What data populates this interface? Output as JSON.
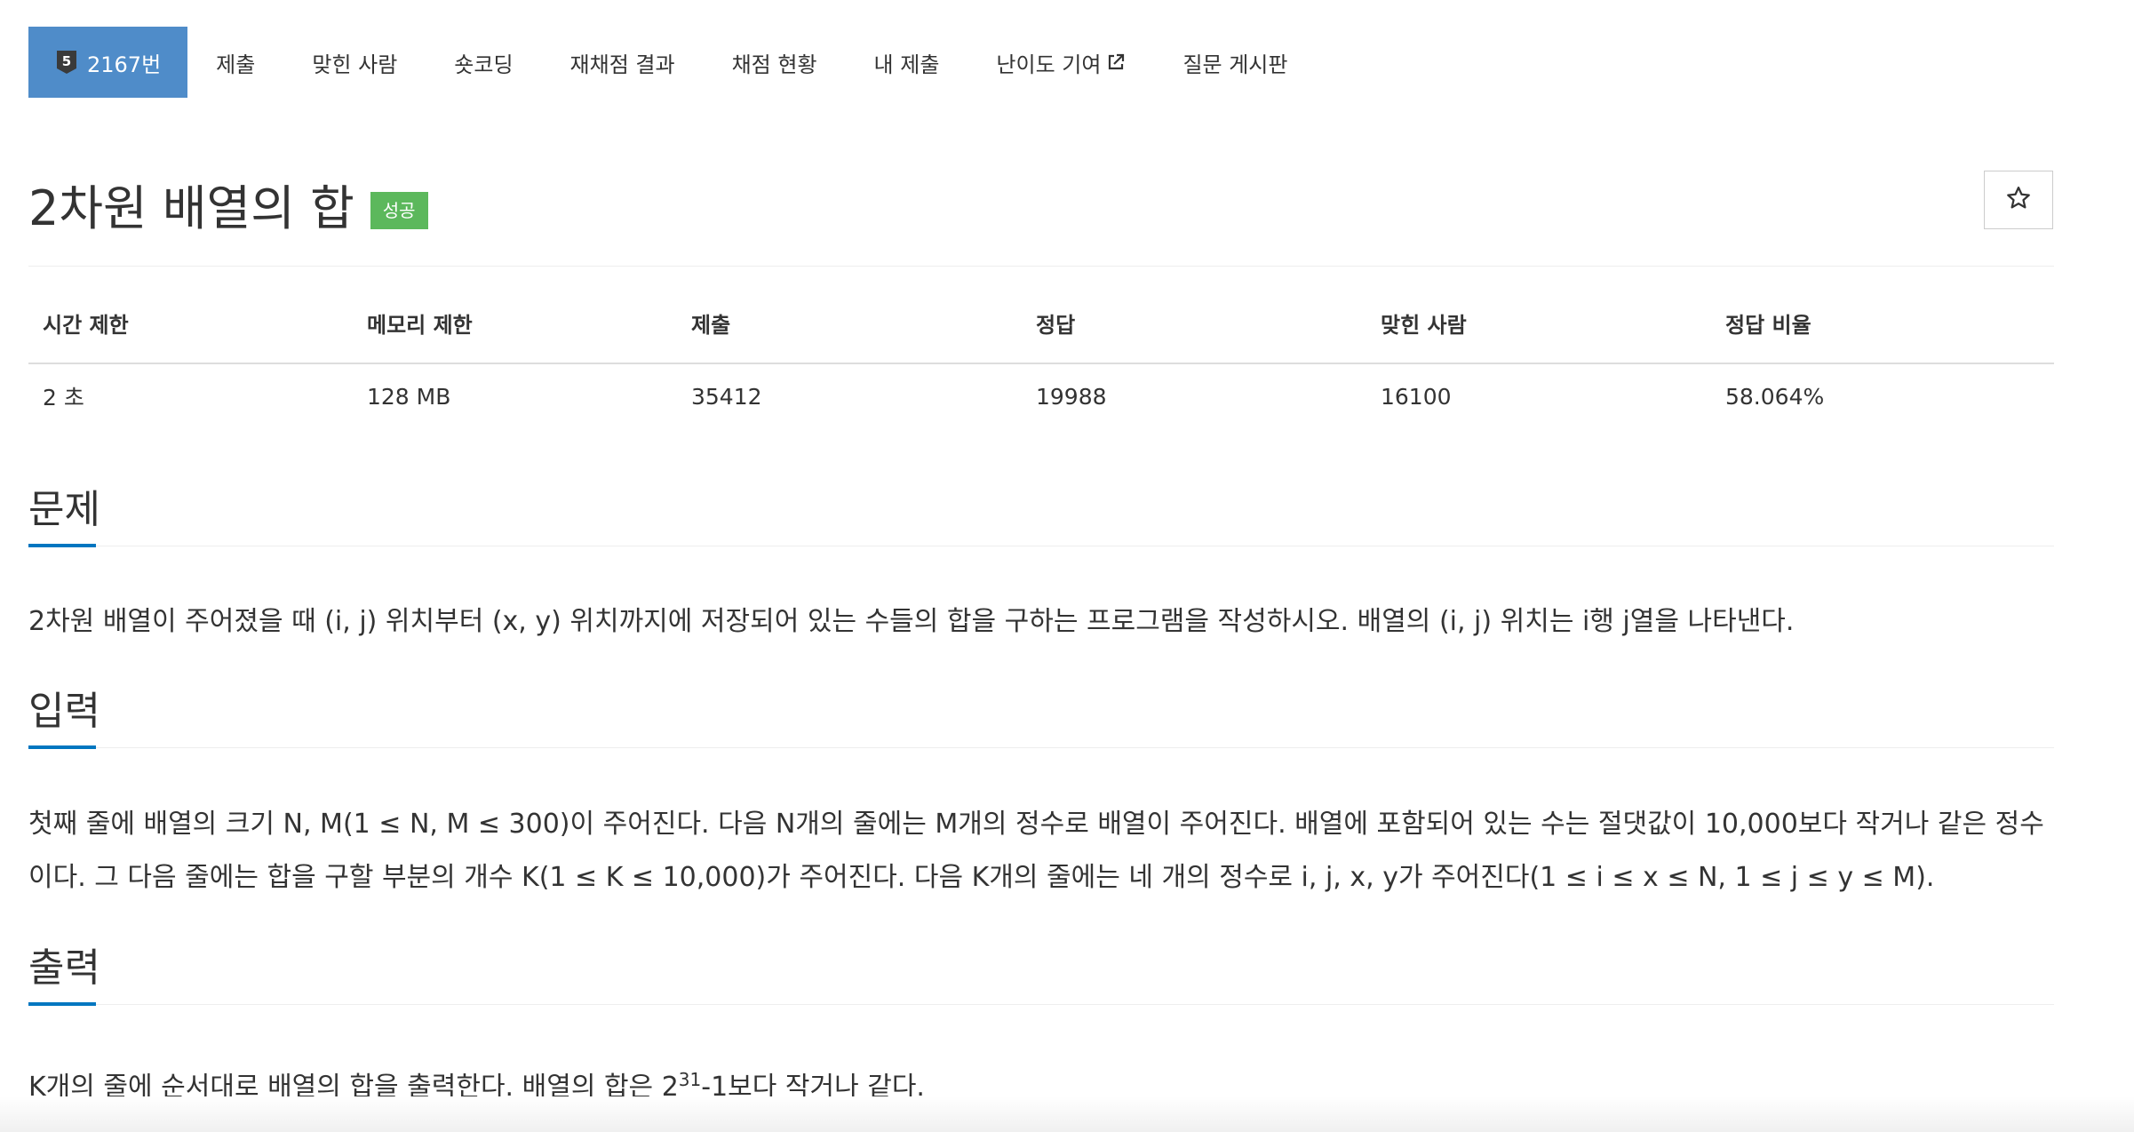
{
  "tabs": [
    {
      "label": "2167번",
      "tier": "5",
      "active": true
    },
    {
      "label": "제출"
    },
    {
      "label": "맞힌 사람"
    },
    {
      "label": "숏코딩"
    },
    {
      "label": "재채점 결과"
    },
    {
      "label": "채점 현황"
    },
    {
      "label": "내 제출"
    },
    {
      "label": "난이도 기여",
      "external": true
    },
    {
      "label": "질문 게시판"
    }
  ],
  "problem": {
    "title": "2차원 배열의 합",
    "status_badge": "성공",
    "star_icon": "star-outline"
  },
  "info_table": {
    "headers": [
      "시간 제한",
      "메모리 제한",
      "제출",
      "정답",
      "맞힌 사람",
      "정답 비율"
    ],
    "values": [
      "2 초",
      "128 MB",
      "35412",
      "19988",
      "16100",
      "58.064%"
    ]
  },
  "sections": {
    "problem": {
      "heading": "문제",
      "text": "2차원 배열이 주어졌을 때 (i, j) 위치부터 (x, y) 위치까지에 저장되어 있는 수들의 합을 구하는 프로그램을 작성하시오. 배열의 (i, j) 위치는 i행 j열을 나타낸다."
    },
    "input": {
      "heading": "입력",
      "text": "첫째 줄에 배열의 크기 N, M(1 ≤ N, M ≤ 300)이 주어진다. 다음 N개의 줄에는 M개의 정수로 배열이 주어진다. 배열에 포함되어 있는 수는 절댓값이 10,000보다 작거나 같은 정수이다. 그 다음 줄에는 합을 구할 부분의 개수 K(1 ≤ K ≤ 10,000)가 주어진다. 다음 K개의 줄에는 네 개의 정수로 i, j, x, y가 주어진다(1 ≤ i ≤ x ≤ N, 1 ≤ j ≤ y ≤ M)."
    },
    "output": {
      "heading": "출력",
      "text_before": "K개의 줄에 순서대로 배열의 합을 출력한다. 배열의 합은 2",
      "exponent": "31",
      "text_after": "-1보다 작거나 같다."
    }
  },
  "colors": {
    "active_tab": "#4f8cc9",
    "success_badge": "#5cb85c",
    "section_underline": "#0076c0",
    "tier_badge": "#3a3a3a"
  }
}
